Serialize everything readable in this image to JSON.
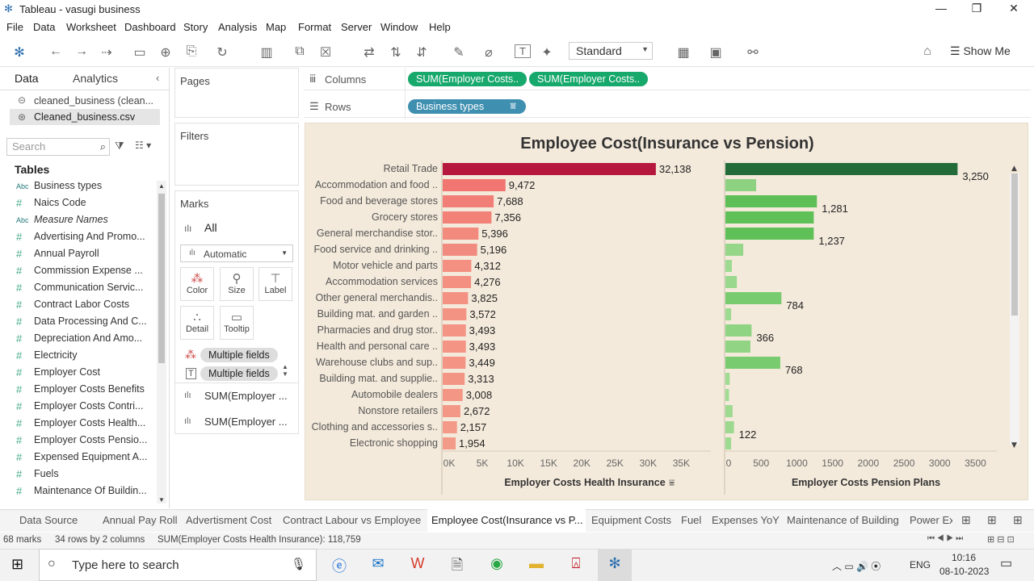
{
  "window": {
    "title": "Tableau - vasugi business"
  },
  "menu": [
    "File",
    "Data",
    "Worksheet",
    "Dashboard",
    "Story",
    "Analysis",
    "Map",
    "Format",
    "Server",
    "Window",
    "Help"
  ],
  "toolbar": {
    "view_size": "Standard",
    "show_me": "Show Me"
  },
  "data_pane": {
    "tab_data": "Data",
    "tab_analytics": "Analytics",
    "sources": [
      "cleaned_business (clean...",
      "Cleaned_business.csv"
    ],
    "search_placeholder": "Search",
    "tables_label": "Tables",
    "fields": [
      {
        "type": "Abc",
        "name": "Business types"
      },
      {
        "type": "#",
        "name": "Naics Code"
      },
      {
        "type": "Abc",
        "name": "Measure Names"
      },
      {
        "type": "#",
        "name": "Advertising And Promo..."
      },
      {
        "type": "#",
        "name": "Annual Payroll"
      },
      {
        "type": "#",
        "name": "Commission Expense ..."
      },
      {
        "type": "#",
        "name": "Communication Servic..."
      },
      {
        "type": "#",
        "name": "Contract Labor Costs"
      },
      {
        "type": "#",
        "name": "Data Processing And C..."
      },
      {
        "type": "#",
        "name": "Depreciation And Amo..."
      },
      {
        "type": "#",
        "name": "Electricity"
      },
      {
        "type": "#",
        "name": "Employer Cost"
      },
      {
        "type": "#",
        "name": "Employer Costs Benefits"
      },
      {
        "type": "#",
        "name": "Employer Costs Contri..."
      },
      {
        "type": "#",
        "name": "Employer Costs Health..."
      },
      {
        "type": "#",
        "name": "Employer Costs Pensio..."
      },
      {
        "type": "#",
        "name": "Expensed Equipment A..."
      },
      {
        "type": "#",
        "name": "Fuels"
      },
      {
        "type": "#",
        "name": "Maintenance Of Buildin..."
      }
    ]
  },
  "cards": {
    "pages": "Pages",
    "filters": "Filters",
    "marks": "Marks",
    "marks_all": "All",
    "mark_type": "Automatic",
    "buttons": [
      "Color",
      "Size",
      "Label",
      "Detail",
      "Tooltip"
    ],
    "multi1": "Multiple fields",
    "multi2": "Multiple fields",
    "measure1": "SUM(Employer ...",
    "measure2": "SUM(Employer ..."
  },
  "shelves": {
    "columns_label": "Columns",
    "rows_label": "Rows",
    "columns_pills": [
      "SUM(Employer Costs..",
      "SUM(Employer Costs.."
    ],
    "rows_pill": "Business types"
  },
  "chart_data": {
    "type": "bar",
    "title": "Employee Cost(Insurance vs Pension)",
    "categories": [
      "Retail Trade",
      "Accommodation and food ..",
      "Food and beverage stores",
      "Grocery stores",
      "General merchandise stor..",
      "Food service and drinking ..",
      "Motor vehicle and parts",
      "Accommodation services",
      "Other general merchandis..",
      "Building mat. and garden ..",
      "Pharmacies and drug stor..",
      "Health and personal care ..",
      "Warehouse clubs and sup..",
      "Building mat. and supplie..",
      "Automobile dealers",
      "Nonstore retailers",
      "Clothing and accessories s..",
      "Electronic shopping"
    ],
    "series": [
      {
        "name": "Employer Costs Health Insurance",
        "values": [
          32138,
          9472,
          7688,
          7356,
          5396,
          5196,
          4312,
          4276,
          3825,
          3572,
          3493,
          3493,
          3449,
          3313,
          3008,
          2672,
          2157,
          1954
        ]
      },
      {
        "name": "Employer Costs Pension Plans",
        "values": [
          3250,
          430,
          1281,
          1237,
          1237,
          250,
          90,
          160,
          784,
          80,
          366,
          350,
          768,
          60,
          50,
          100,
          120,
          80
        ]
      }
    ],
    "pension_labels": {
      "0": "3,250",
      "2": "1,281",
      "4": "1,237",
      "8": "784",
      "10": "366",
      "12": "768",
      "16": "122"
    },
    "health_axis": {
      "label": "Employer Costs Health Insurance",
      "ticks": [
        "0K",
        "5K",
        "10K",
        "15K",
        "20K",
        "25K",
        "30K",
        "35K"
      ],
      "range": [
        0,
        38000
      ]
    },
    "pension_axis": {
      "label": "Employer Costs Pension Plans",
      "ticks": [
        "0",
        "500",
        "1000",
        "1500",
        "2000",
        "2500",
        "3000",
        "3500"
      ],
      "range": [
        0,
        3800
      ]
    },
    "colors": {
      "health_max": "#b5173d",
      "health_low": "#f4a58f",
      "pension_max": "#236b38",
      "pension_low": "#a3dc95"
    }
  },
  "sheet_tabs": [
    "Data Source",
    "Annual Pay Roll",
    "Advertisment Cost",
    "Contract Labour vs Employee",
    "Employee Cost(Insurance vs P...",
    "Equipment Costs",
    "Fuel",
    "Expenses YoY",
    "Maintenance of Building",
    "Power Ex"
  ],
  "status": {
    "marks": "68 marks",
    "rows_cols": "34 rows by 2 columns",
    "sum": "SUM(Employer Costs Health Insurance): 118,759"
  },
  "taskbar": {
    "search_placeholder": "Type here to search",
    "lang": "ENG",
    "time": "10:16",
    "date": "08-10-2023"
  }
}
